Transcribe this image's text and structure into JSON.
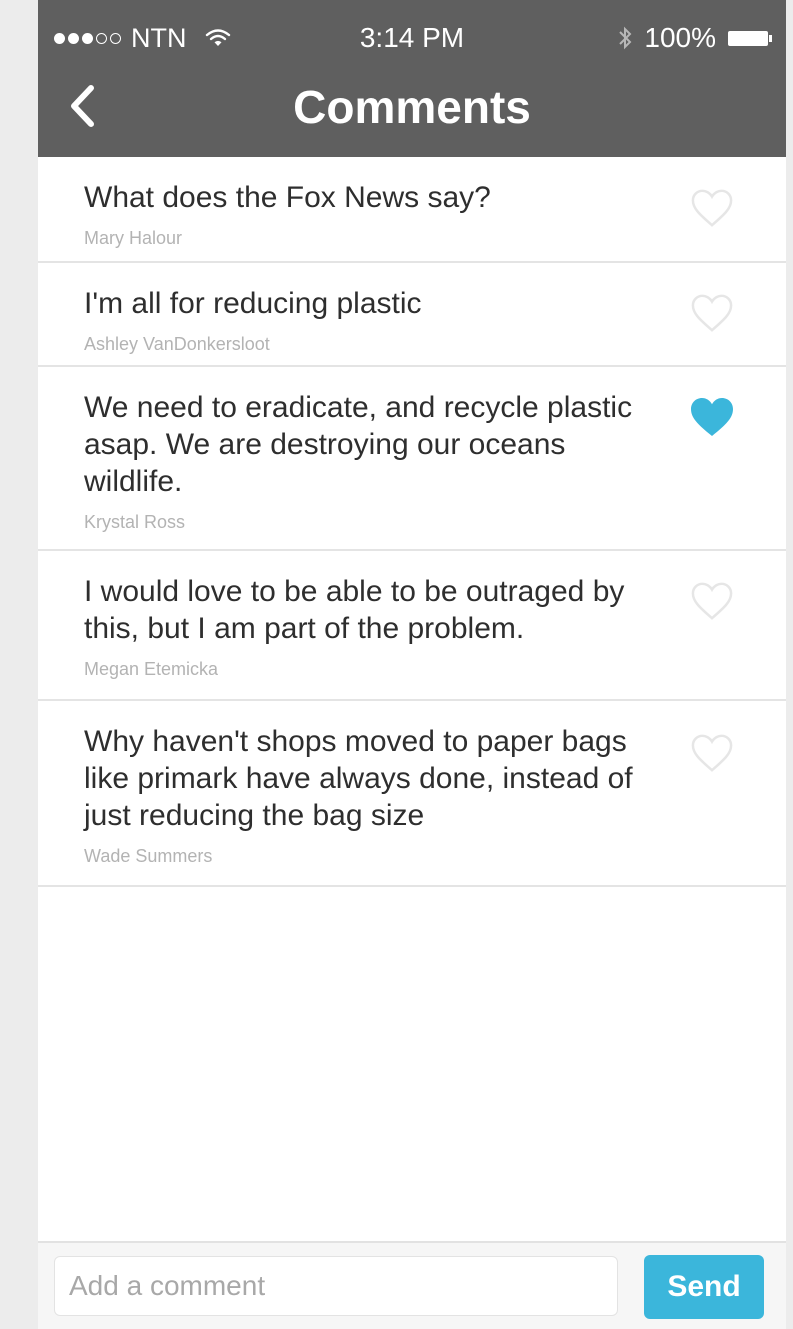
{
  "status_bar": {
    "carrier": "NTN",
    "signal_bars_filled": 3,
    "signal_bars_total": 5,
    "time": "3:14 PM",
    "battery": "100%"
  },
  "nav": {
    "title": "Comments",
    "back_icon": "chevron-left-icon"
  },
  "comments": [
    {
      "text": "What does the Fox News say?",
      "author": "Mary Halour",
      "liked": false
    },
    {
      "text": "I'm all for reducing plastic",
      "author": "Ashley VanDonkersloot",
      "liked": false
    },
    {
      "text": "We need to eradicate, and recycle plastic asap. We are destroying our oceans wildlife.",
      "author": "Krystal Ross",
      "liked": true
    },
    {
      "text": "I would love to be able to be outraged by this, but I am part of the problem.",
      "author": "Megan Etemicka",
      "liked": false
    },
    {
      "text": "Why haven't shops moved to paper bags like primark have always done, instead of just reducing the bag size",
      "author": "Wade Summers",
      "liked": false
    }
  ],
  "composer": {
    "placeholder": "Add a comment",
    "value": "",
    "send_label": "Send"
  },
  "colors": {
    "header_bg": "#5f5f5f",
    "accent": "#3bb6db",
    "heart_liked": "#3bb6db",
    "heart_unliked": "#e6e6e6"
  }
}
